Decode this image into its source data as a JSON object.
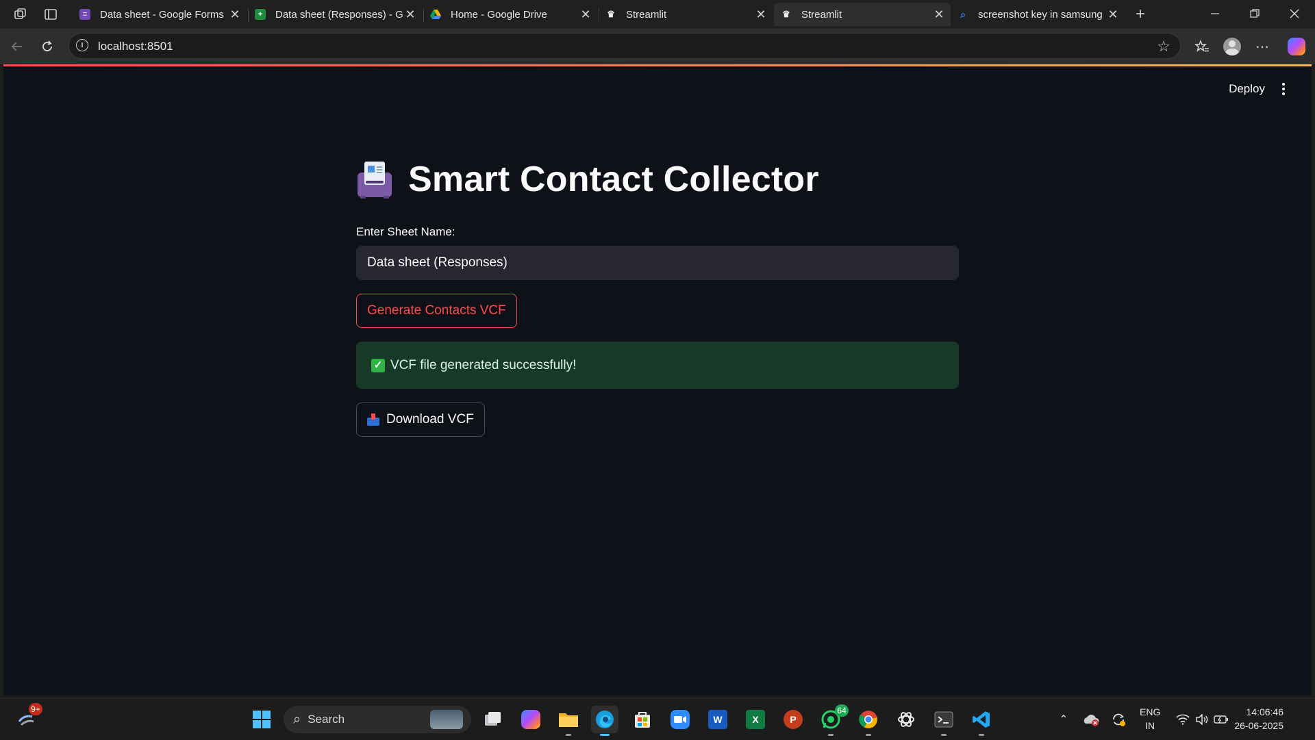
{
  "browser": {
    "tabs": [
      {
        "title": "Data sheet - Google Forms",
        "favicon": "google-forms-icon",
        "color": "#7248b9"
      },
      {
        "title": "Data sheet (Responses) - G",
        "favicon": "google-sheets-icon",
        "color": "#1e8e3e"
      },
      {
        "title": "Home - Google Drive",
        "favicon": "google-drive-icon",
        "color": "#f4b400"
      },
      {
        "title": "Streamlit",
        "favicon": "streamlit-icon",
        "color": "#ff4b4b"
      },
      {
        "title": "Streamlit",
        "favicon": "streamlit-icon",
        "color": "#ff4b4b",
        "active": true
      },
      {
        "title": "screenshot key in samsung",
        "favicon": "search-icon",
        "color": "#3b82f6"
      }
    ],
    "new_tab_glyph": "+",
    "url": "localhost:8501",
    "info_glyph": "i"
  },
  "app": {
    "header": {
      "deploy_label": "Deploy"
    },
    "title": "Smart Contact Collector",
    "sheet_label": "Enter Sheet Name:",
    "sheet_value": "Data sheet (Responses)",
    "generate_label": "Generate Contacts VCF",
    "success_message": "VCF file generated successfully!",
    "download_label": "Download VCF",
    "accent_color": "#ff4b4b",
    "background_color": "#0e1117",
    "success_bg": "#173928"
  },
  "taskbar": {
    "search_placeholder": "Search",
    "widgets_badge": "9+",
    "whatsapp_badge": "64",
    "apps": [
      "windows-start-icon",
      "search",
      "task-view-icon",
      "copilot-icon",
      "file-explorer-icon",
      "edge-icon",
      "ms-store-icon",
      "zoom-icon",
      "word-icon",
      "excel-icon",
      "powerpoint-icon",
      "whatsapp-icon",
      "chrome-icon",
      "chatgpt-icon",
      "terminal-icon",
      "vscode-icon"
    ],
    "language": "ENG",
    "region": "IN",
    "time": "14:06:46",
    "date": "26-06-2025"
  }
}
